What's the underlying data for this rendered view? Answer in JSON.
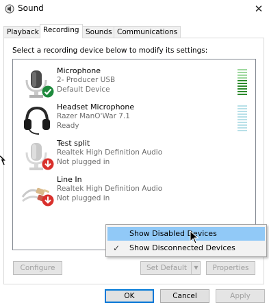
{
  "window": {
    "title": "Sound",
    "close_glyph": "✕"
  },
  "tabs": [
    {
      "label": "Playback"
    },
    {
      "label": "Recording"
    },
    {
      "label": "Sounds"
    },
    {
      "label": "Communications"
    }
  ],
  "instruction": "Select a recording device below to modify its settings:",
  "devices": [
    {
      "name": "Microphone",
      "line1": "2- Producer USB",
      "line2": "Default Device",
      "icon": "microphone-icon",
      "status": "default-check"
    },
    {
      "name": "Headset Microphone",
      "line1": "Razer ManO'War 7.1",
      "line2": "Ready",
      "icon": "headset-icon",
      "status": "none"
    },
    {
      "name": "Test split",
      "line1": "Realtek High Definition Audio",
      "line2": "Not plugged in",
      "icon": "microphone-icon",
      "status": "unplugged-arrow"
    },
    {
      "name": "Line In",
      "line1": "Realtek High Definition Audio",
      "line2": "Not plugged in",
      "icon": "line-in-cable-icon",
      "status": "unplugged-arrow"
    }
  ],
  "context_menu": {
    "items": [
      {
        "label": "Show Disabled Devices",
        "checked": false,
        "highlighted": true
      },
      {
        "label": "Show Disconnected Devices",
        "checked": true,
        "highlighted": false
      }
    ]
  },
  "buttons": {
    "configure": "Configure",
    "set_default": "Set Default",
    "properties": "Properties",
    "ok": "OK",
    "cancel": "Cancel",
    "apply": "Apply"
  },
  "colors": {
    "accent": "#0078d7",
    "menu_highlight": "#91c9f7",
    "check_green": "#1e8a3c",
    "unplugged_red": "#d9302c",
    "meter_green": "#2e8b2e"
  }
}
